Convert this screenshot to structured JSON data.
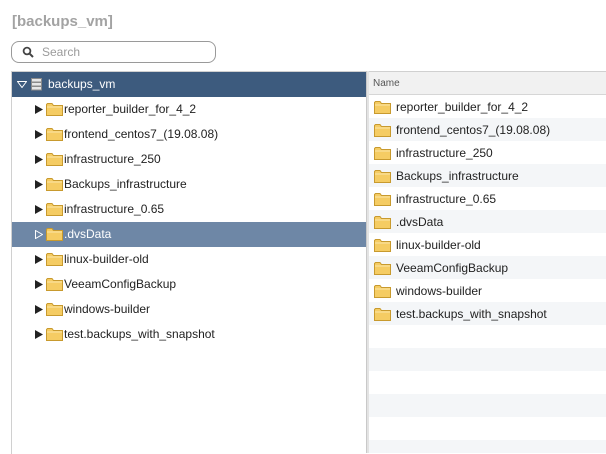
{
  "title": "[backups_vm]",
  "search": {
    "placeholder": "Search",
    "value": ""
  },
  "tree": {
    "root": {
      "label": "backups_vm",
      "expanded": true
    },
    "items": [
      {
        "label": "reporter_builder_for_4_2"
      },
      {
        "label": "frontend_centos7_(19.08.08)"
      },
      {
        "label": "infrastructure_250"
      },
      {
        "label": "Backups_infrastructure"
      },
      {
        "label": "infrastructure_0.65"
      },
      {
        "label": ".dvsData",
        "selected": true
      },
      {
        "label": "linux-builder-old"
      },
      {
        "label": "VeeamConfigBackup"
      },
      {
        "label": "windows-builder"
      },
      {
        "label": "test.backups_with_snapshot"
      }
    ]
  },
  "list": {
    "column_name": "Name",
    "items": [
      {
        "label": "reporter_builder_for_4_2"
      },
      {
        "label": "frontend_centos7_(19.08.08)"
      },
      {
        "label": "infrastructure_250"
      },
      {
        "label": "Backups_infrastructure"
      },
      {
        "label": "infrastructure_0.65"
      },
      {
        "label": ".dvsData"
      },
      {
        "label": "linux-builder-old"
      },
      {
        "label": "VeeamConfigBackup"
      },
      {
        "label": "windows-builder"
      },
      {
        "label": "test.backups_with_snapshot"
      }
    ]
  },
  "icons": {
    "folder": "folder-icon",
    "datastore": "datastore-icon",
    "search": "search-icon",
    "expand": "triangle-right-icon",
    "collapse": "triangle-down-icon"
  },
  "colors": {
    "root_row": "#3d5b7e",
    "selected_row": "#6e87a6",
    "folder_fill": "#f5cc63",
    "folder_stroke": "#c89a2e",
    "title": "#a3a3a3"
  }
}
